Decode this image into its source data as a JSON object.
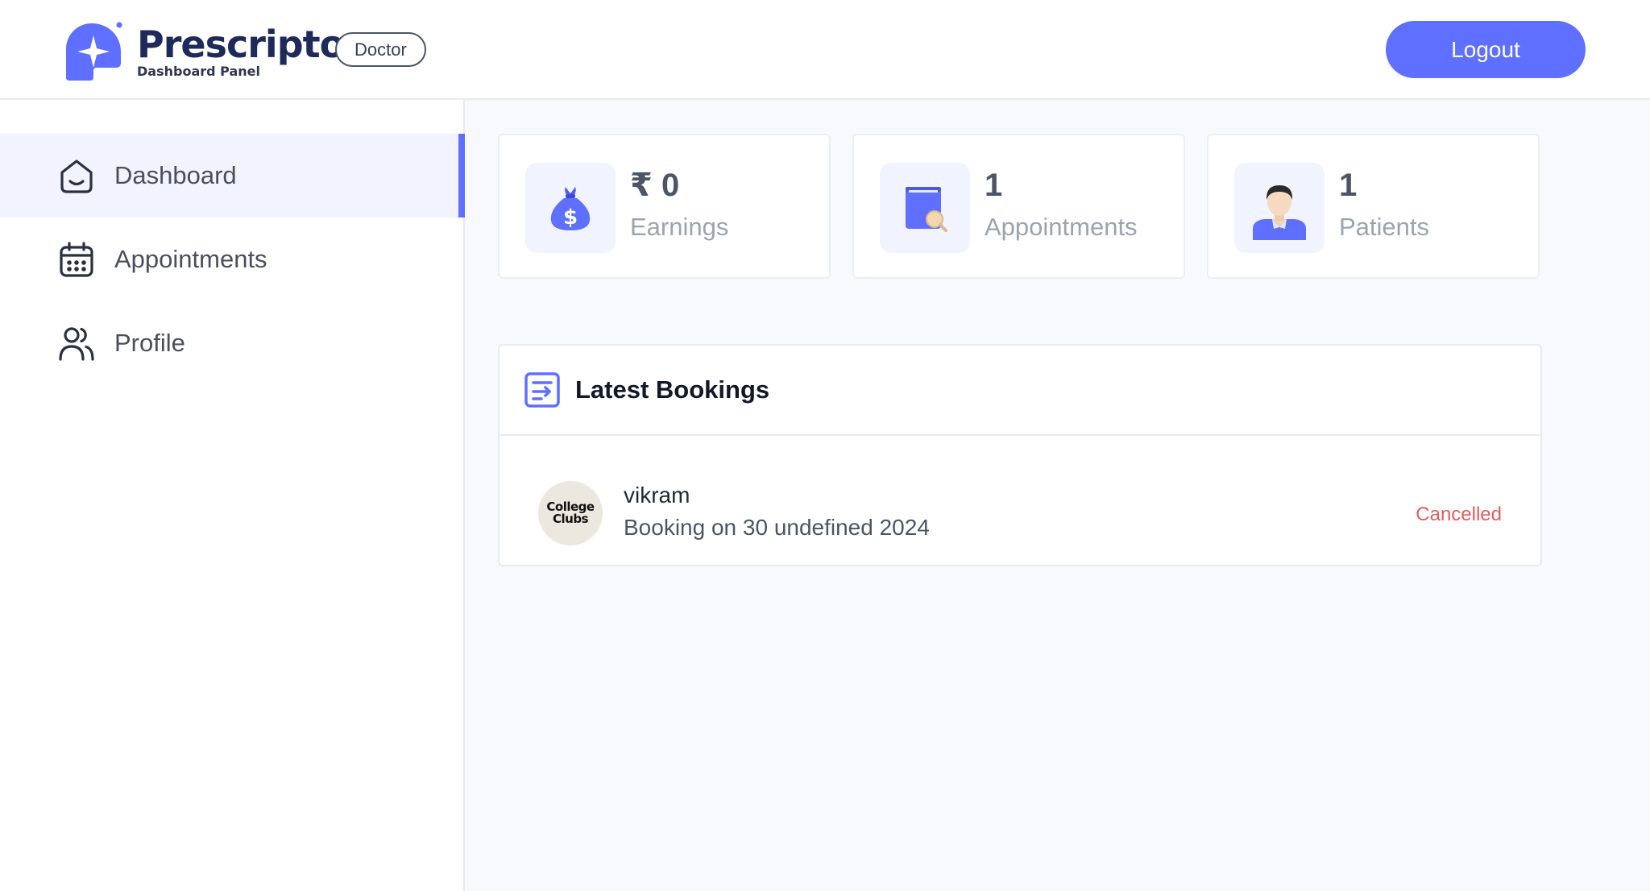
{
  "header": {
    "brand_name": "Prescripto",
    "brand_subtitle": "Dashboard Panel",
    "role_badge": "Doctor",
    "logout_label": "Logout"
  },
  "sidebar": {
    "items": [
      {
        "label": "Dashboard",
        "icon": "home-icon",
        "active": true
      },
      {
        "label": "Appointments",
        "icon": "calendar-icon",
        "active": false
      },
      {
        "label": "Profile",
        "icon": "people-icon",
        "active": false
      }
    ]
  },
  "stats": [
    {
      "value": "₹ 0",
      "label": "Earnings",
      "icon": "money-bag-icon"
    },
    {
      "value": "1",
      "label": "Appointments",
      "icon": "appointment-book-icon"
    },
    {
      "value": "1",
      "label": "Patients",
      "icon": "patient-avatar-icon"
    }
  ],
  "latest_bookings": {
    "title": "Latest Bookings",
    "icon": "list-icon",
    "rows": [
      {
        "avatar_text_line1": "College",
        "avatar_text_line2": "Clubs",
        "name": "vikram",
        "date": "Booking on 30 undefined 2024",
        "status": "Cancelled"
      }
    ]
  },
  "colors": {
    "accent": "#5f6fff",
    "active_nav_bg": "#f2f3ff",
    "cancelled": "#e05d5d",
    "main_bg": "#f8f9fd"
  }
}
